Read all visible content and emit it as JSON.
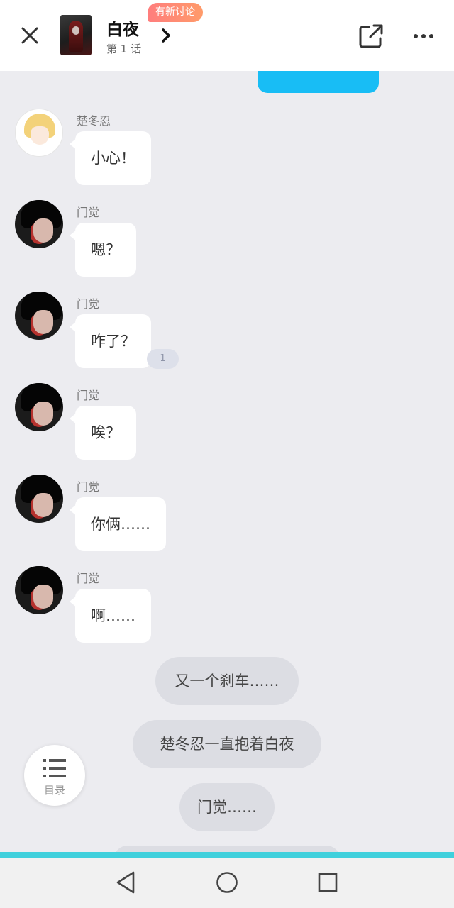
{
  "header": {
    "title": "白夜",
    "episode": "第 1 话",
    "badge": "有新讨论"
  },
  "messages": [
    {
      "sender": "楚冬忍",
      "text": "小心！",
      "avatar": "blond-boy-avatar"
    },
    {
      "sender": "门觉",
      "text": "嗯？",
      "avatar": "dark-hair-avatar"
    },
    {
      "sender": "门觉",
      "text": "咋了？",
      "avatar": "dark-hair-avatar",
      "comment_count": "1"
    },
    {
      "sender": "门觉",
      "text": "唉？",
      "avatar": "dark-hair-avatar"
    },
    {
      "sender": "门觉",
      "text": "你俩……",
      "avatar": "dark-hair-avatar"
    },
    {
      "sender": "门觉",
      "text": "啊……",
      "avatar": "dark-hair-avatar"
    }
  ],
  "narration": [
    "又一个刹车……",
    "楚冬忍一直抱着白夜",
    "门觉……"
  ],
  "catalog": {
    "label": "目录",
    "icon": "list-icon"
  },
  "colors": {
    "own_bubble": "#18bdf5",
    "badge_start": "#ff7d7d",
    "badge_end": "#ff9b6a",
    "progress": "#3fd0dc",
    "background": "#ececf0"
  },
  "icons": {
    "close": "close-icon",
    "chevron": "chevron-right-icon",
    "share": "share-icon",
    "more": "more-icon",
    "nav_back": "nav-back-icon",
    "nav_home": "nav-home-icon",
    "nav_recent": "nav-recent-icon"
  }
}
